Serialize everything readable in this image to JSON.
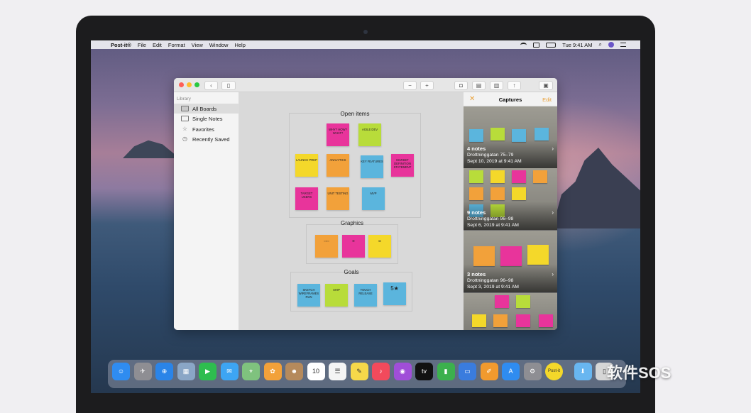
{
  "menubar": {
    "apple_glyph": "",
    "app_name": "Post-it®",
    "items": [
      "File",
      "Edit",
      "Format",
      "View",
      "Window",
      "Help"
    ],
    "clock": "Tue 9:41 AM"
  },
  "toolbar": {
    "back_glyph": "‹",
    "sidebar_glyph": "▯",
    "zoom_out_glyph": "−",
    "zoom_in_glyph": "+",
    "camera_glyph": "◘",
    "note_glyph": "▤",
    "trash_glyph": "▥",
    "share_glyph": "↑",
    "captures_glyph": "▣"
  },
  "sidebar": {
    "heading": "Library",
    "items": [
      {
        "label": "All Boards",
        "icon": "boards-icon"
      },
      {
        "label": "Single Notes",
        "icon": "note-icon"
      },
      {
        "label": "Favorites",
        "icon": "star-icon"
      },
      {
        "label": "Recently Saved",
        "icon": "clock-icon"
      }
    ]
  },
  "board": {
    "clusters": [
      {
        "title": "Open items",
        "notes": [
          {
            "text": "Why? How? What?",
            "color": "#e8349b"
          },
          {
            "text": "Agile Dev",
            "color": "#b8dc3a"
          },
          {
            "text": "Launch Prep",
            "color": "#f4d82a"
          },
          {
            "text": "Analytics",
            "color": "#f2a13a"
          },
          {
            "text": "Key Features",
            "color": "#5bb5dd"
          },
          {
            "text": "Market Definition Statement",
            "color": "#e8349b"
          },
          {
            "text": "Target Users",
            "color": "#e8349b"
          },
          {
            "text": "Unit Testing",
            "color": "#f2a13a"
          },
          {
            "text": "MVP",
            "color": "#5bb5dd"
          }
        ]
      },
      {
        "title": "Graphics",
        "notes": [
          {
            "text": "",
            "color": "#f2a13a"
          },
          {
            "text": "",
            "color": "#e8349b"
          },
          {
            "text": "",
            "color": "#f4d82a"
          }
        ]
      },
      {
        "title": "Goals",
        "notes": [
          {
            "text": "Sketch Wireframes Run",
            "color": "#5bb5dd"
          },
          {
            "text": "Ship",
            "color": "#b8dc3a"
          },
          {
            "text": "Touch Release",
            "color": "#5bb5dd"
          },
          {
            "text": "5★",
            "color": "#5bb5dd"
          }
        ]
      }
    ]
  },
  "captures": {
    "title": "Captures",
    "close_glyph": "✕",
    "edit_label": "Edit",
    "chevron": "›",
    "items": [
      {
        "count": "4 notes",
        "place": "Drottninggatan 75–79",
        "date": "Sept 10, 2019 at 9:41 AM"
      },
      {
        "count": "9 notes",
        "place": "Drottninggatan 96–98",
        "date": "Sept 6, 2019 at 9:41 AM"
      },
      {
        "count": "3 notes",
        "place": "Drottninggatan 96–98",
        "date": "Sept 3, 2019 at 9:41 AM"
      }
    ]
  },
  "dock": {
    "apps": [
      {
        "name": "finder-icon",
        "color": "#2f8cf0",
        "glyph": "☺"
      },
      {
        "name": "launchpad-icon",
        "color": "#8e8e93",
        "glyph": "✈"
      },
      {
        "name": "safari-icon",
        "color": "#2a84e8",
        "glyph": "⊕"
      },
      {
        "name": "photo-slideshow-icon",
        "color": "#8aa6c6",
        "glyph": "▦"
      },
      {
        "name": "facetime-icon",
        "color": "#2ebd4f",
        "glyph": "▶"
      },
      {
        "name": "messages-icon",
        "color": "#3da5f3",
        "glyph": "✉"
      },
      {
        "name": "maps-icon",
        "color": "#7fc27e",
        "glyph": "⌖"
      },
      {
        "name": "photos-icon",
        "color": "#f2a13a",
        "glyph": "✿"
      },
      {
        "name": "contacts-icon",
        "color": "#b58a5c",
        "glyph": "☻"
      },
      {
        "name": "calendar-icon",
        "color": "#ffffff",
        "glyph": "10"
      },
      {
        "name": "reminders-icon",
        "color": "#f4f4f4",
        "glyph": "☰"
      },
      {
        "name": "notes-icon",
        "color": "#f6d84a",
        "glyph": "✎"
      },
      {
        "name": "music-icon",
        "color": "#f24a5c",
        "glyph": "♪"
      },
      {
        "name": "podcasts-icon",
        "color": "#a04ed8",
        "glyph": "◉"
      },
      {
        "name": "tv-icon",
        "color": "#111111",
        "glyph": "tv"
      },
      {
        "name": "numbers-icon",
        "color": "#3cb04d",
        "glyph": "▮"
      },
      {
        "name": "keynote-icon",
        "color": "#3a7cde",
        "glyph": "▭"
      },
      {
        "name": "pages-icon",
        "color": "#f19a2e",
        "glyph": "✐"
      },
      {
        "name": "app-store-icon",
        "color": "#2f8cf0",
        "glyph": "A"
      },
      {
        "name": "system-preferences-icon",
        "color": "#8e8e93",
        "glyph": "⚙"
      },
      {
        "name": "post-it-app-icon",
        "color": "#f4d82a",
        "glyph": "Post-it"
      },
      {
        "name": "downloads-folder-icon",
        "color": "#68b6f0",
        "glyph": "⬇"
      },
      {
        "name": "trash-icon",
        "color": "#d6d6d6",
        "glyph": "▯"
      }
    ]
  },
  "watermark": "软件SOS"
}
